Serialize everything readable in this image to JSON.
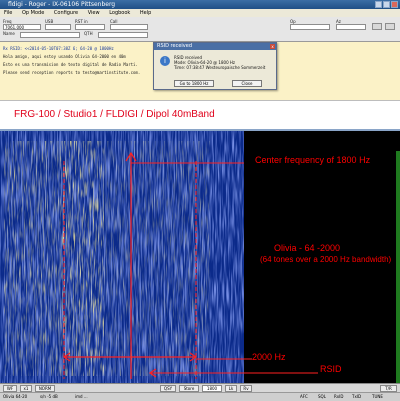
{
  "window": {
    "title": "fldigi - Roger - IX-06106 Pittsenberg"
  },
  "menu": [
    "File",
    "Op Mode",
    "Configure",
    "View",
    "Logbook",
    "Help"
  ],
  "controls": {
    "frequency_label": "Freq",
    "frequency_value": "7061.000",
    "mode_label": "USB",
    "rst_label": "RST in",
    "call_label": "Call",
    "name_label": "Name",
    "qth_label": "QTH",
    "op_label": "Op",
    "az_label": "Az"
  },
  "rx_text": {
    "lines": [
      "Rx RSID: <<2014-05-10T07:38Z 6; 64-20 @ 1800Hz",
      "Hola amigo, aqui estoy usando Olivia 64-2000 en 40m",
      "Esto es una transmision de texto digital de Radio Marti.",
      "",
      "Please send reception reports to testo@martinstitute.com."
    ],
    "highlight": "Rx RSID: <<2014-05-10T07:38Z 6; 64-20 @ 1800Hz"
  },
  "rsid_dialog": {
    "title": "RSID received",
    "close_glyph": "x",
    "icon_glyph": "i",
    "line1": "RSID received",
    "line2": "Mode: Olivia-64-20 @ 1800 Hz",
    "line3": "Time: 07:38:47 Westeuropaische Sommerzeit",
    "line4": "",
    "btn_ok": "Go to 1800 Hz",
    "btn_close": "Close"
  },
  "banner": {
    "text": "FRG-100 / Studio1 / FLDIGI /  Dipol 40mBand"
  },
  "annotations": {
    "center": "Center frequency of 1800 Hz",
    "mode": "Olivia - 64 -2000",
    "tones": "(64 tones over a 2000 Hz bandwidth)",
    "bandwidth": "2000 Hz",
    "rsid": "RSID"
  },
  "waterfall_controls": {
    "wf": "WF",
    "x1": "x1",
    "norm": "NORM",
    "qsy": "QSY",
    "store": "Store",
    "lk": "Lk",
    "rv": "Rv",
    "tuned": "1800",
    "t_r": "T/R"
  },
  "statusbar": {
    "mode": "Olivia 64-20",
    "sn": "s/n -5 dB",
    "imd": "imd ...",
    "afc": "AFC",
    "sql": "SQL",
    "rxid": "RxID",
    "txid": "TxID",
    "tune": "TUNE"
  },
  "colors": {
    "annotation": "#ff0000",
    "banner_text": "#e0001a",
    "waterfall_bg": "#000000",
    "waterfall_noise": "#0b2a8a",
    "signal": "#ffd64a"
  }
}
